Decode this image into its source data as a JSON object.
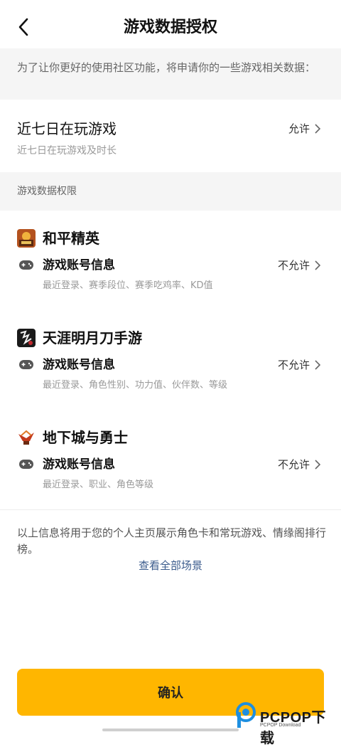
{
  "header": {
    "title": "游戏数据授权",
    "back_icon": "chevron-left-icon"
  },
  "intro": {
    "text": "为了让你更好的使用社区功能，将申请你的一些游戏相关数据："
  },
  "recent_games": {
    "title": "近七日在玩游戏",
    "subtitle": "近七日在玩游戏及时长",
    "status": "允许"
  },
  "section": {
    "title": "游戏数据权限"
  },
  "games": [
    {
      "name": "和平精英",
      "icon": "peacekeeper-elite-app-icon",
      "account_label": "游戏账号信息",
      "description": "最近登录、赛季段位、赛季吃鸡率、KD值",
      "status": "不允许"
    },
    {
      "name": "天涯明月刀手游",
      "icon": "tianya-mingyuedao-app-icon",
      "account_label": "游戏账号信息",
      "description": "最近登录、角色性别、功力值、伙伴数、等级",
      "status": "不允许"
    },
    {
      "name": "地下城与勇士",
      "icon": "dnf-app-icon",
      "account_label": "游戏账号信息",
      "description": "最近登录、职业、角色等级",
      "status": "不允许"
    }
  ],
  "footer": {
    "note": "以上信息将用于您的个人主页展示角色卡和常玩游戏、情缘阁排行榜。",
    "view_all": "查看全部场景"
  },
  "confirm": {
    "label": "确认"
  },
  "watermark": {
    "brand": "PCPOP下载",
    "sub": "PCPOP Download"
  },
  "colors": {
    "accent": "#ffb600",
    "link": "#3b5b8c",
    "background_gray": "#f5f5f5"
  }
}
